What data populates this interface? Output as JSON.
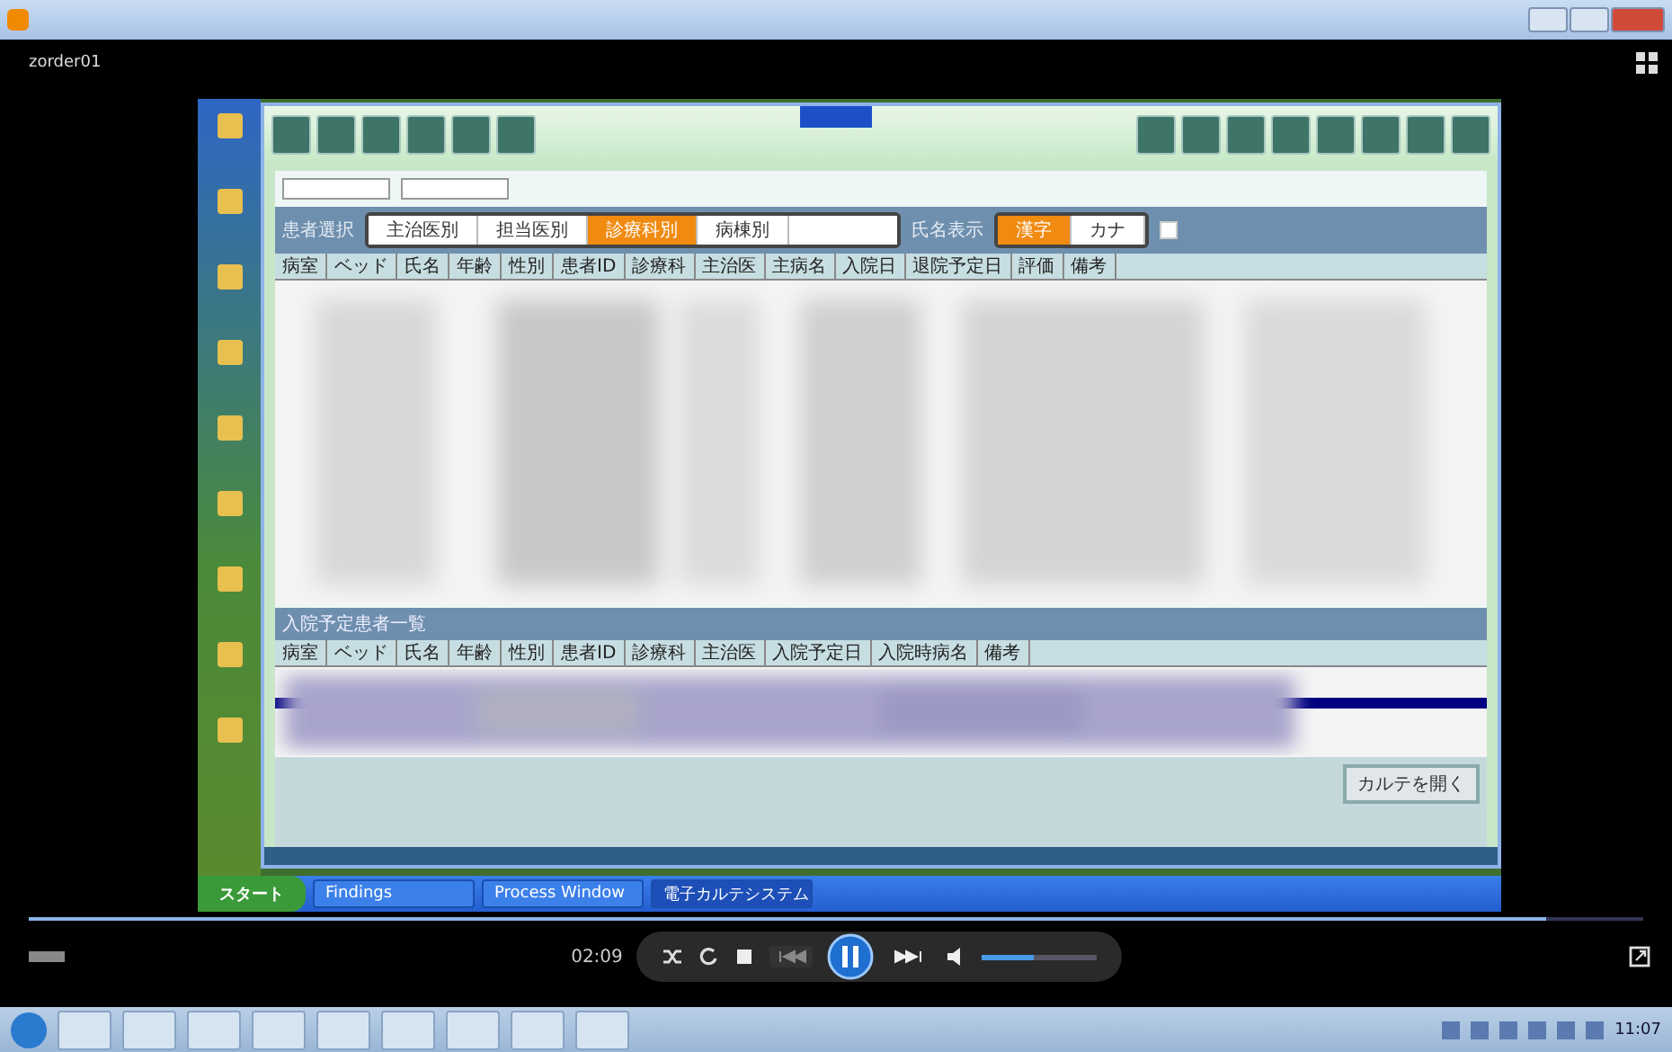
{
  "player": {
    "file_name": "zorder01",
    "time": "02:09",
    "progress": {
      "level": 0.94
    },
    "volume": {
      "level": 0.45
    },
    "playing": true
  },
  "recording": {
    "tabs_label": "患者選択",
    "tabs": [
      {
        "label": "主治医別",
        "selected": false
      },
      {
        "label": "担当医別",
        "selected": false
      },
      {
        "label": "診療科別",
        "selected": true
      },
      {
        "label": "病棟別",
        "selected": false
      }
    ],
    "display_label": "氏名表示",
    "display": [
      {
        "label": "漢字",
        "selected": true
      },
      {
        "label": "カナ",
        "selected": false
      }
    ],
    "show_checkbox": {
      "checked": false
    },
    "upper_columns": [
      "病室",
      "ベッド",
      "氏名",
      "年齢",
      "性別",
      "患者ID",
      "診療科",
      "主治医",
      "主病名",
      "入院日",
      "退院予定日",
      "評価",
      "備考"
    ],
    "lower_title": "入院予定患者一覧",
    "lower_columns": [
      "病室",
      "ベッド",
      "氏名",
      "年齢",
      "性別",
      "患者ID",
      "診療科",
      "主治医",
      "入院予定日",
      "入院時病名",
      "備考"
    ],
    "open_button": "カルテを開く",
    "start_button": "スタート",
    "taskbar_items": [
      {
        "label": "Findings",
        "selected": false
      },
      {
        "label": "Process Window",
        "selected": false
      },
      {
        "label": "電子カルテシステム",
        "selected": true
      }
    ]
  },
  "taskbar": {
    "clock": "11:07"
  }
}
